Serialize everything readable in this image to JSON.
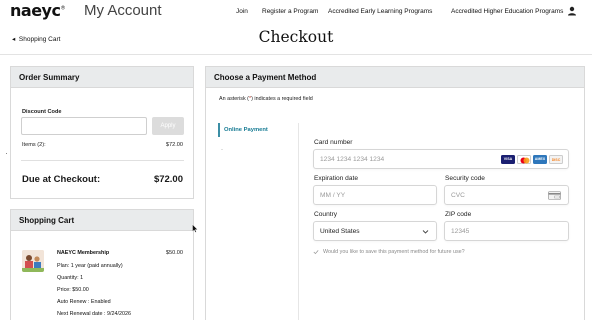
{
  "header": {
    "logo": "naeyc",
    "logo_tm": "®",
    "title": "My Account",
    "nav": [
      "Join",
      "Register a Program",
      "Accredited Early Learning Programs",
      "Accredited Higher Education Programs"
    ]
  },
  "breadcrumb": {
    "back_label": "Shopping Cart"
  },
  "page": {
    "title": "Checkout"
  },
  "order_summary": {
    "heading": "Order Summary",
    "discount_label": "Discount Code",
    "discount_value": "",
    "apply_label": "Apply",
    "items_label": "Items (2):",
    "items_value": "$72.00",
    "due_label": "Due at Checkout:",
    "due_value": "$72.00"
  },
  "shopping_cart": {
    "heading": "Shopping Cart",
    "item": {
      "name": "NAEYC Membership",
      "price": "$50.00",
      "plan": "Plan: 1 year (paid annually)",
      "quantity": "Quantity: 1",
      "price_line": "Price: $50.00",
      "auto_renew": "Auto Renew :  Enabled",
      "next_renewal": "Next Renewal date :  9/24/2026"
    }
  },
  "payment": {
    "heading": "Choose a Payment Method",
    "asterisk_prefix": "An asterisk (",
    "asterisk_mark": "*",
    "asterisk_suffix": ") indicates a required field",
    "methods": [
      "Online Payment",
      "·"
    ],
    "card_number_label": "Card number",
    "card_number_placeholder": "1234 1234 1234 1234",
    "brands": [
      {
        "name": "VISA",
        "color": "#1a1f71"
      },
      {
        "name": "MC",
        "color": "#eb001b"
      },
      {
        "name": "AMEX",
        "color": "#2e77bb"
      },
      {
        "name": "DISC",
        "color": "#f58220"
      }
    ],
    "expiration_label": "Expiration date",
    "expiration_placeholder": "MM / YY",
    "security_label": "Security code",
    "security_placeholder": "CVC",
    "country_label": "Country",
    "country_value": "United States",
    "zip_label": "ZIP code",
    "zip_placeholder": "12345",
    "save_note": "Would you like to save this payment method for future use?"
  },
  "colors": {
    "accent": "#157a93",
    "panel_header": "#e9ebec",
    "border": "#d9d9d9"
  }
}
